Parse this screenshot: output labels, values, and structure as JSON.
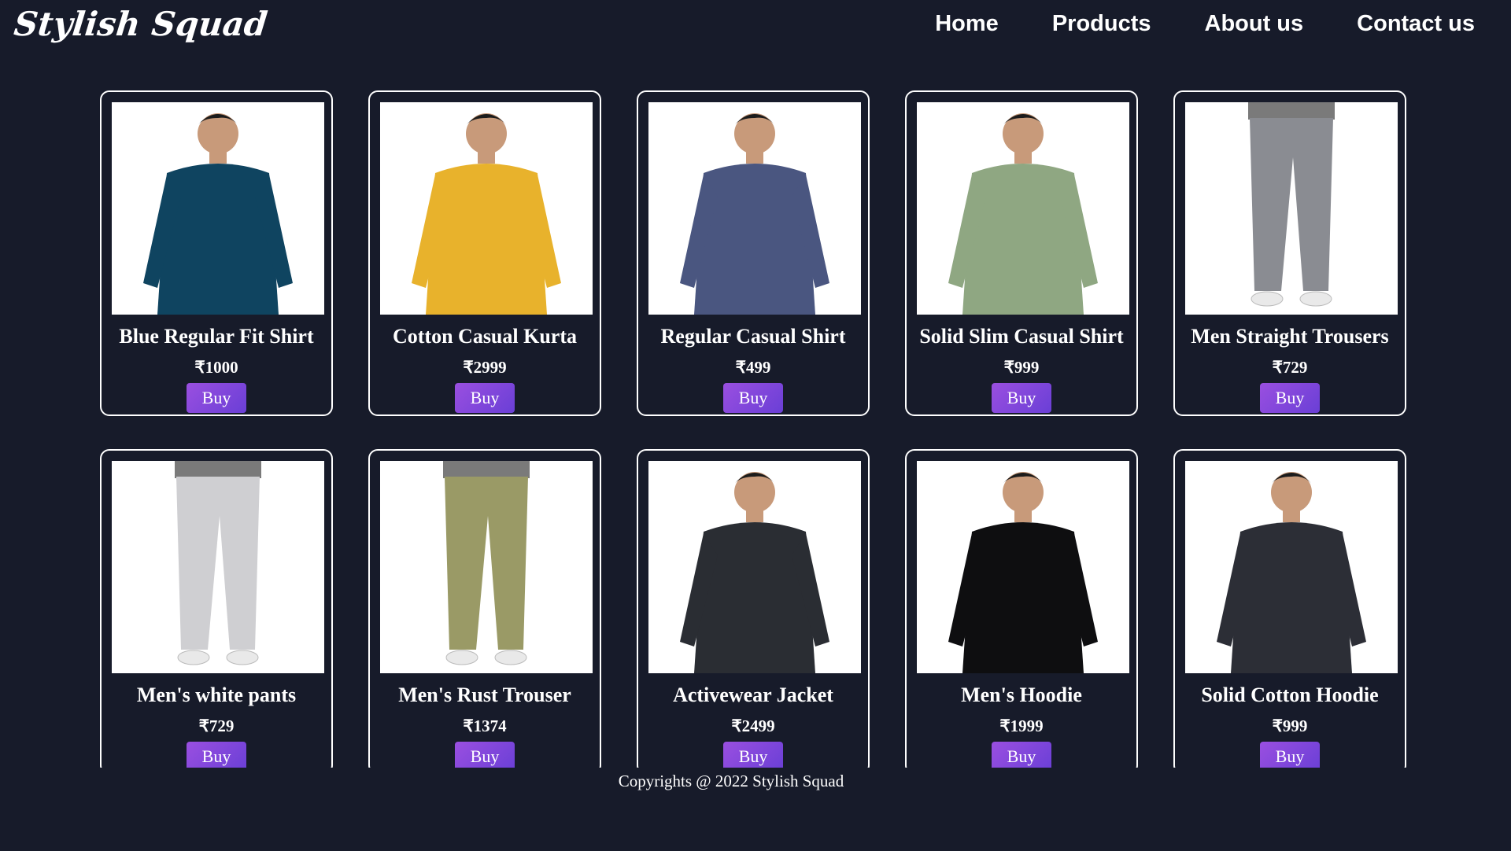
{
  "header": {
    "logo": "Stylish Squad",
    "nav": [
      "Home",
      "Products",
      "About us",
      "Contact us"
    ]
  },
  "products": [
    {
      "title": "Blue Regular Fit Shirt",
      "price": "₹1000",
      "buy": "Buy",
      "icon": "blue-shirt-photo",
      "color": "#0f4460"
    },
    {
      "title": "Cotton Casual Kurta",
      "price": "₹2999",
      "buy": "Buy",
      "icon": "yellow-kurta-photo",
      "color": "#e8b22c"
    },
    {
      "title": "Regular Casual Shirt",
      "price": "₹499",
      "buy": "Buy",
      "icon": "navy-shirt-photo",
      "color": "#4a5680"
    },
    {
      "title": "Solid Slim Casual Shirt",
      "price": "₹999",
      "buy": "Buy",
      "icon": "green-shirt-photo",
      "color": "#8fa782"
    },
    {
      "title": "Men Straight Trousers",
      "price": "₹729",
      "buy": "Buy",
      "icon": "grey-trousers-photo",
      "color": "#8a8c92"
    },
    {
      "title": "Men's white pants",
      "price": "₹729",
      "buy": "Buy",
      "icon": "white-pants-photo",
      "color": "#cfcfd2"
    },
    {
      "title": "Men's Rust Trouser",
      "price": "₹1374",
      "buy": "Buy",
      "icon": "olive-trouser-photo",
      "color": "#9a9a66"
    },
    {
      "title": "Activewear Jacket",
      "price": "₹2499",
      "buy": "Buy",
      "icon": "black-jacket-photo",
      "color": "#2a2d33"
    },
    {
      "title": "Men's Hoodie",
      "price": "₹1999",
      "buy": "Buy",
      "icon": "black-hoodie-photo",
      "color": "#0e0e10"
    },
    {
      "title": "Solid Cotton Hoodie",
      "price": "₹999",
      "buy": "Buy",
      "icon": "dark-hoodie-photo",
      "color": "#2c2e36"
    }
  ],
  "footer": {
    "text": "Copyrights @ 2022 Stylish Squad"
  },
  "colors": {
    "background": "#171b2a",
    "button_gradient_start": "#9a4fe0",
    "button_gradient_end": "#6a3fd6"
  }
}
